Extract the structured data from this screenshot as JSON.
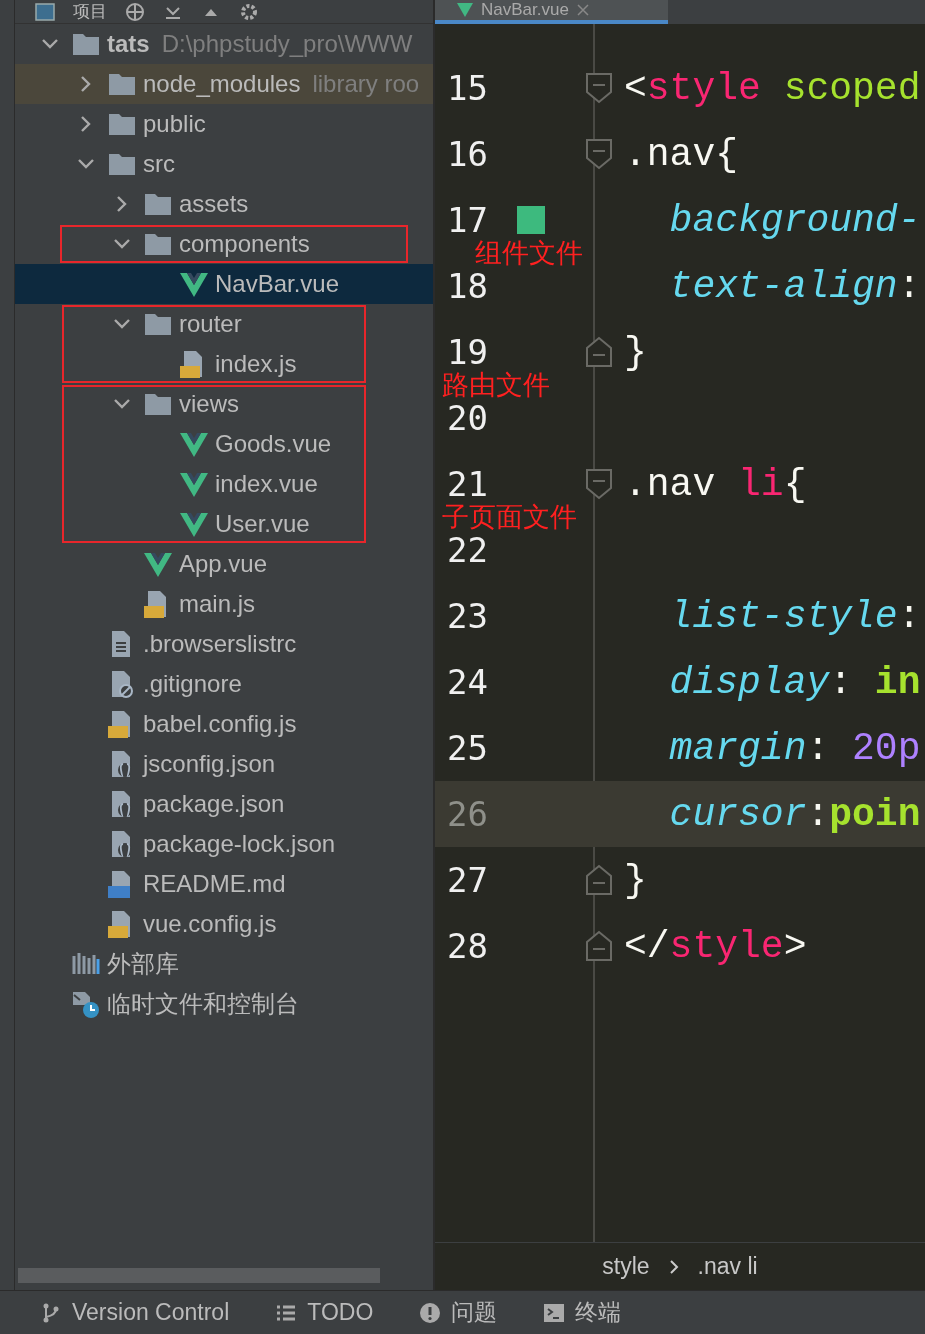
{
  "toolbar": {
    "title": "项目"
  },
  "editor_tab": {
    "label": "NavBar.vue",
    "selected": true
  },
  "project_tree": [
    {
      "name": "tats",
      "path": "D:\\phpstudy_pro\\WWW",
      "kind": "folder",
      "expanded": true,
      "selected": false,
      "highlighted": false,
      "children": [
        {
          "name": "node_modules",
          "hint": "library roo",
          "kind": "folder",
          "expanded": false,
          "selected": false,
          "highlighted": true
        },
        {
          "name": "public",
          "kind": "folder",
          "expanded": false,
          "selected": false,
          "highlighted": false
        },
        {
          "name": "src",
          "kind": "folder",
          "expanded": true,
          "selected": false,
          "highlighted": false,
          "children": [
            {
              "name": "assets",
              "kind": "folder",
              "expanded": false,
              "selected": false,
              "highlighted": false
            },
            {
              "name": "components",
              "kind": "folder",
              "expanded": true,
              "selected": false,
              "highlighted": false,
              "annotation": {
                "label": "组件文件",
                "covers_children": false
              },
              "children": [
                {
                  "name": "NavBar.vue",
                  "kind": "vue",
                  "selected": true,
                  "highlighted": false
                }
              ]
            },
            {
              "name": "router",
              "kind": "folder",
              "expanded": true,
              "selected": false,
              "highlighted": false,
              "annotation": {
                "label": "路由文件",
                "covers_children": true
              },
              "children": [
                {
                  "name": "index.js",
                  "kind": "js",
                  "selected": false,
                  "highlighted": false
                }
              ]
            },
            {
              "name": "views",
              "kind": "folder",
              "expanded": true,
              "selected": false,
              "highlighted": false,
              "annotation": {
                "label": "子页面文件",
                "covers_children": true
              },
              "children": [
                {
                  "name": "Goods.vue",
                  "kind": "vue",
                  "selected": false,
                  "highlighted": false
                },
                {
                  "name": "index.vue",
                  "kind": "vue",
                  "selected": false,
                  "highlighted": false
                },
                {
                  "name": "User.vue",
                  "kind": "vue",
                  "selected": false,
                  "highlighted": false
                }
              ]
            },
            {
              "name": "App.vue",
              "kind": "vue",
              "selected": false,
              "highlighted": false
            },
            {
              "name": "main.js",
              "kind": "js",
              "selected": false,
              "highlighted": false
            }
          ]
        },
        {
          "name": ".browserslistrc",
          "kind": "text",
          "selected": false,
          "highlighted": false
        },
        {
          "name": ".gitignore",
          "kind": "ignore",
          "selected": false,
          "highlighted": false
        },
        {
          "name": "babel.config.js",
          "kind": "js",
          "selected": false,
          "highlighted": false
        },
        {
          "name": "jsconfig.json",
          "kind": "json",
          "selected": false,
          "highlighted": false
        },
        {
          "name": "package.json",
          "kind": "json",
          "selected": false,
          "highlighted": false
        },
        {
          "name": "package-lock.json",
          "kind": "json",
          "selected": false,
          "highlighted": false
        },
        {
          "name": "README.md",
          "kind": "md",
          "selected": false,
          "highlighted": false
        },
        {
          "name": "vue.config.js",
          "kind": "js",
          "selected": false,
          "highlighted": false
        }
      ]
    },
    {
      "name": "外部库",
      "kind": "library",
      "selected": false,
      "highlighted": false
    },
    {
      "name": "临时文件和控制台",
      "kind": "scratch",
      "selected": false,
      "highlighted": false
    }
  ],
  "code_lines": [
    {
      "number": "15",
      "kind": "opener",
      "current": false,
      "tokens": [
        {
          "kind": "punct",
          "text": "<"
        },
        {
          "kind": "tag",
          "text": "style"
        },
        {
          "kind": "attr",
          "text": " scoped"
        }
      ]
    },
    {
      "number": "16",
      "kind": "opener",
      "current": false,
      "tokens": [
        {
          "kind": "selector",
          "text": ".nav"
        },
        {
          "kind": "punct",
          "text": "{"
        }
      ]
    },
    {
      "number": "17",
      "kind": "swatch",
      "current": false,
      "tokens": [
        {
          "kind": "property",
          "text": "  background-"
        }
      ]
    },
    {
      "number": "18",
      "kind": "plain",
      "current": false,
      "tokens": [
        {
          "kind": "property",
          "text": "  text-align"
        },
        {
          "kind": "punct",
          "text": ":"
        }
      ]
    },
    {
      "number": "19",
      "kind": "closer",
      "current": false,
      "tokens": [
        {
          "kind": "punct",
          "text": "}"
        }
      ]
    },
    {
      "number": "20",
      "kind": "plain",
      "current": false
    },
    {
      "number": "21",
      "kind": "opener",
      "current": false,
      "tokens": [
        {
          "kind": "selector",
          "text": ".nav"
        },
        {
          "kind": "tag",
          "text": " li"
        },
        {
          "kind": "punct",
          "text": "{"
        }
      ]
    },
    {
      "number": "22",
      "kind": "plain",
      "current": false
    },
    {
      "number": "23",
      "kind": "plain",
      "current": false,
      "tokens": [
        {
          "kind": "property",
          "text": "  list-style"
        },
        {
          "kind": "punct",
          "text": ":"
        }
      ]
    },
    {
      "number": "24",
      "kind": "plain",
      "current": false,
      "tokens": [
        {
          "kind": "property",
          "text": "  display"
        },
        {
          "kind": "punct",
          "text": ": "
        },
        {
          "kind": "value",
          "text": "in"
        }
      ]
    },
    {
      "number": "25",
      "kind": "plain",
      "current": false,
      "tokens": [
        {
          "kind": "property",
          "text": "  margin"
        },
        {
          "kind": "punct",
          "text": ": "
        },
        {
          "kind": "number",
          "text": "20p"
        }
      ]
    },
    {
      "number": "26",
      "kind": "plain",
      "current": true,
      "tokens": [
        {
          "kind": "property",
          "text": "  cursor"
        },
        {
          "kind": "punct",
          "text": ":"
        },
        {
          "kind": "value",
          "text": "poin"
        }
      ]
    },
    {
      "number": "27",
      "kind": "closer",
      "current": false,
      "tokens": [
        {
          "kind": "punct",
          "text": "}"
        }
      ]
    },
    {
      "number": "28",
      "kind": "closer",
      "current": false,
      "tokens": [
        {
          "kind": "punct",
          "text": "</"
        },
        {
          "kind": "tag",
          "text": "style"
        },
        {
          "kind": "punct",
          "text": ">"
        }
      ]
    }
  ],
  "breadcrumb": [
    "style",
    ".nav li"
  ],
  "status_bar": [
    {
      "label": "Version Control"
    },
    {
      "label": "TODO"
    },
    {
      "label": "问题"
    },
    {
      "label": "终端"
    }
  ]
}
